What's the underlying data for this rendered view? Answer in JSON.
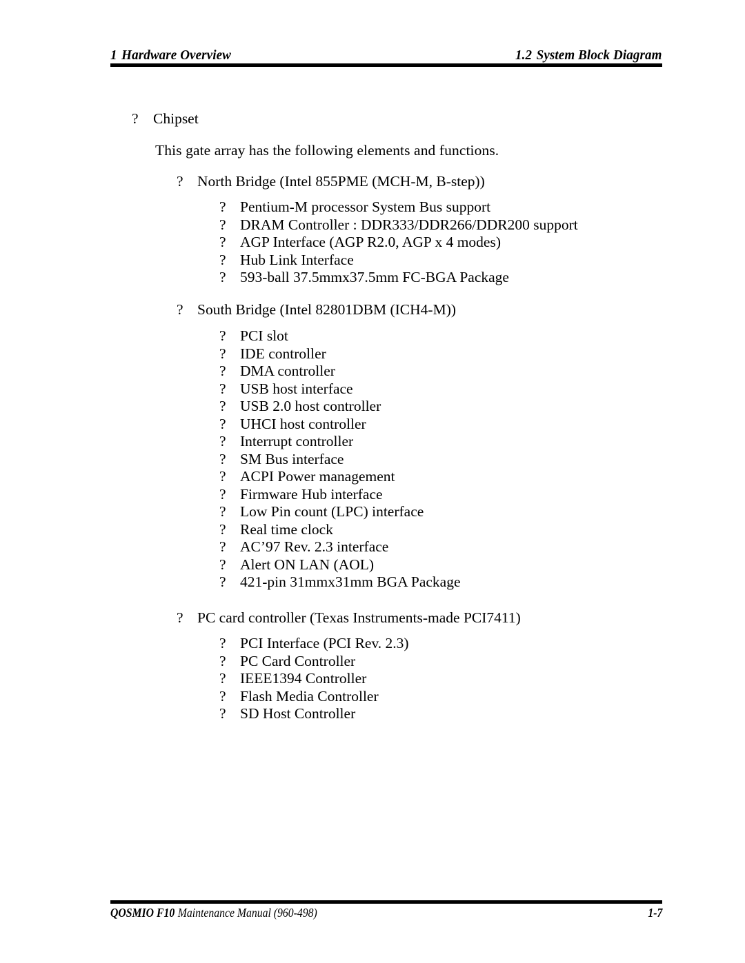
{
  "header": {
    "chapter_number": "1",
    "chapter_title": "Hardware Overview",
    "section_number": "1.2",
    "section_title": "System Block Diagram"
  },
  "footer": {
    "product": "QOSMIO F10",
    "manual": "Maintenance Manual (960-498)",
    "page_number": "1-7"
  },
  "bullet_glyph": "?",
  "body": {
    "topic": "Chipset",
    "intro": "This gate array has the following elements and functions.",
    "groups": [
      {
        "heading": "North Bridge (Intel 855PME  (MCH-M, B-step))",
        "items": [
          "Pentium-M processor System Bus support",
          "DRAM Controller : DDR333/DDR266/DDR200 support",
          "AGP Interface (AGP R2.0, AGP x 4 modes)",
          "Hub Link Interface",
          "593-ball 37.5mmx37.5mm FC-BGA Package"
        ]
      },
      {
        "heading": "South Bridge (Intel 82801DBM (ICH4-M))",
        "items": [
          "PCI slot",
          "IDE controller",
          "DMA controller",
          "USB host interface",
          "USB 2.0 host controller",
          "UHCI host controller",
          "Interrupt controller",
          "SM Bus interface",
          "ACPI Power management",
          "Firmware Hub interface",
          "Low Pin count (LPC) interface",
          "Real time clock",
          "AC’97 Rev. 2.3 interface",
          "Alert ON LAN (AOL)",
          "421-pin 31mmx31mm BGA Package"
        ]
      },
      {
        "heading": "PC card controller (Texas Instruments-made PCI7411)",
        "items": [
          "PCI Interface (PCI Rev. 2.3)",
          "PC Card Controller",
          "IEEE1394 Controller",
          "Flash Media Controller",
          "SD Host Controller"
        ]
      }
    ]
  }
}
